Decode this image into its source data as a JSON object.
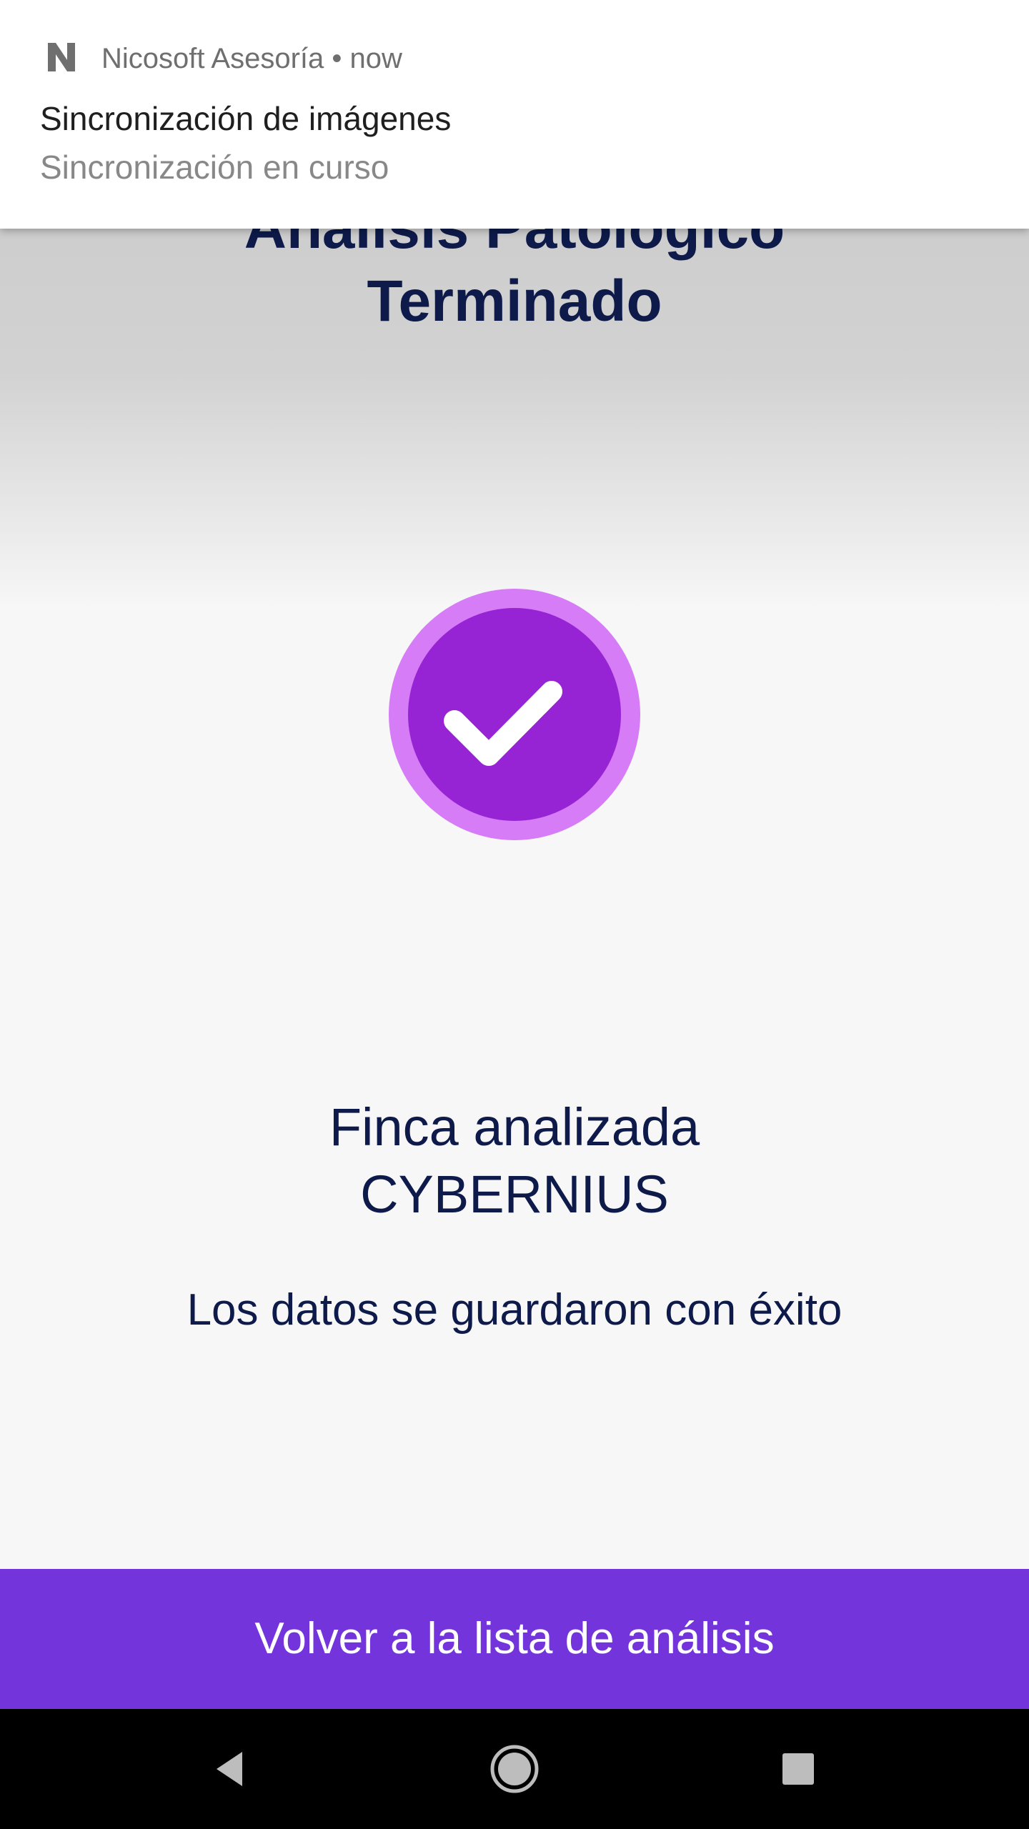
{
  "screen": {
    "title_line_1": "Análisis Patológico",
    "title_line_2": "Terminado",
    "status_icon": "check-circle-icon",
    "farm_label": "Finca analizada",
    "farm_name": "CYBERNIUS",
    "success_message": "Los datos se guardaron con éxito",
    "back_button_label": "Volver a la lista de análisis"
  },
  "notification": {
    "app_icon": "n-logo-icon",
    "app_name": "Nicosoft Asesoría",
    "separator": " • ",
    "time": "now",
    "title": "Sincronización de imágenes",
    "text": "Sincronización en curso"
  },
  "navigation_bar": {
    "back_icon": "back-triangle-icon",
    "home_icon": "home-circle-icon",
    "recents_icon": "recents-square-icon"
  },
  "colors": {
    "primary": "#7334dc",
    "check_inner": "#9724d4",
    "check_outer": "#d57cf6",
    "text_dark": "#0d1a4a"
  }
}
